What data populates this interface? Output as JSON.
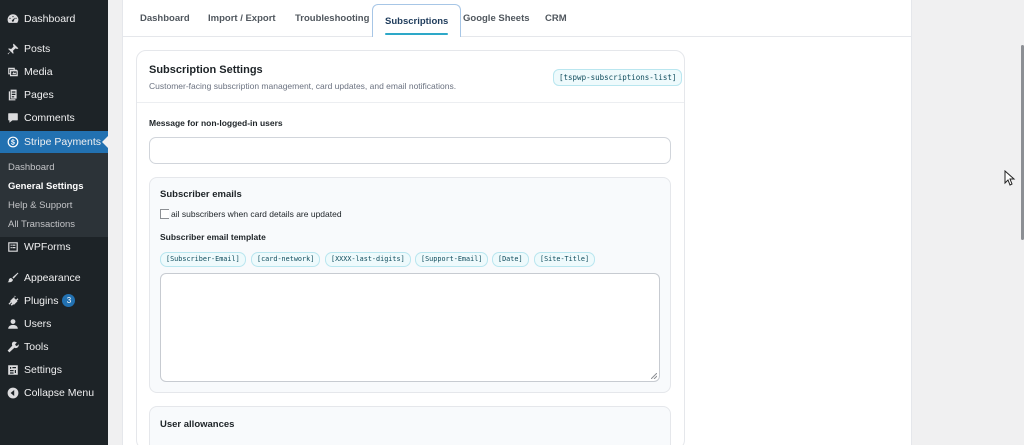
{
  "sidebar": {
    "items": [
      {
        "label": "Dashboard",
        "icon": "dashboard-icon"
      },
      {
        "label": "Posts",
        "icon": "pin-icon"
      },
      {
        "label": "Media",
        "icon": "media-icon"
      },
      {
        "label": "Pages",
        "icon": "pages-icon"
      },
      {
        "label": "Comments",
        "icon": "comment-icon"
      },
      {
        "label": "Stripe Payments",
        "icon": "dollar-icon"
      },
      {
        "label": "WPForms",
        "icon": "form-icon"
      },
      {
        "label": "Appearance",
        "icon": "brush-icon"
      },
      {
        "label": "Plugins",
        "icon": "plug-icon",
        "badge": "3"
      },
      {
        "label": "Users",
        "icon": "user-icon"
      },
      {
        "label": "Tools",
        "icon": "wrench-icon"
      },
      {
        "label": "Settings",
        "icon": "settings-icon"
      },
      {
        "label": "Collapse Menu",
        "icon": "collapse-icon"
      }
    ],
    "submenu": [
      "Dashboard",
      "General Settings",
      "Help & Support",
      "All Transactions"
    ]
  },
  "tabs": [
    "Dashboard",
    "Import / Export",
    "Troubleshooting",
    "Subscriptions",
    "Google Sheets",
    "CRM"
  ],
  "active_tab": "Subscriptions",
  "panel": {
    "title": "Subscription Settings",
    "description": "Customer-facing subscription management, card updates, and email notifications.",
    "shortcode": "[tspwp-subscriptions-list]",
    "message_label": "Message for non-logged-in users",
    "message_value": ""
  },
  "subscriber_emails": {
    "title": "Subscriber emails",
    "checkbox_label": "ail subscribers when card details are updated",
    "checkbox_checked": false,
    "template_label": "Subscriber email template",
    "tags": [
      "[Subscriber-Email]",
      "[card-network]",
      "[XXXX-last-digits]",
      "[Support-Email]",
      "[Date]",
      "[Site-Title]"
    ],
    "template_value": ""
  },
  "user_allowances": {
    "title": "User allowances"
  },
  "colors": {
    "sidebar_bg": "#1d2327",
    "active_menu": "#2271b1",
    "accent": "#2da8c8"
  }
}
